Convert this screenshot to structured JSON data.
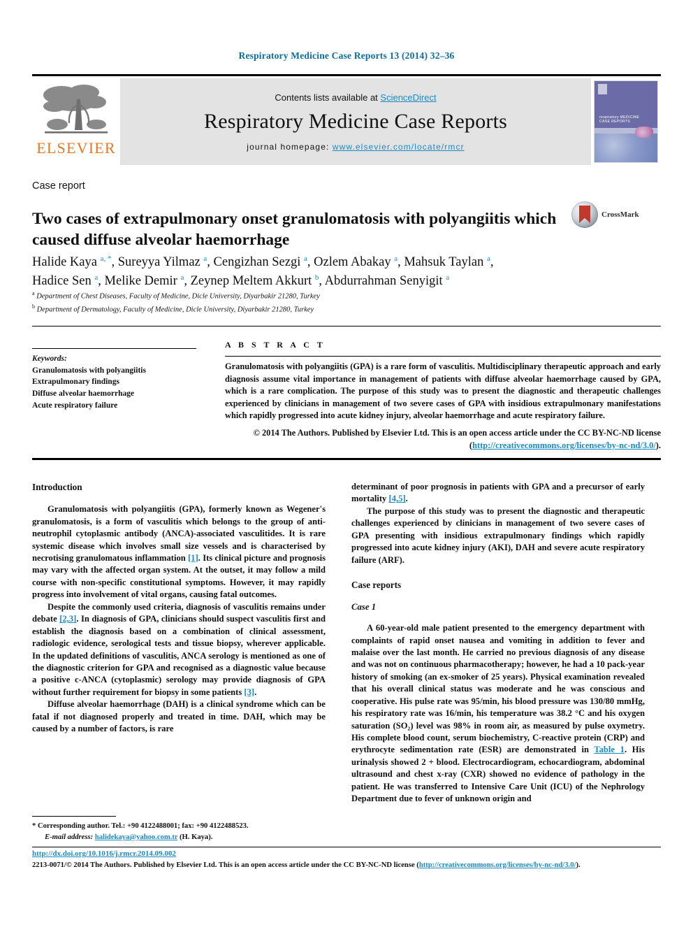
{
  "running_head": "Respiratory Medicine Case Reports 13 (2014) 32–36",
  "masthead": {
    "contents_prefix": "Contents lists available at ",
    "contents_link": "ScienceDirect",
    "journal_title": "Respiratory Medicine Case Reports",
    "homepage_prefix": "journal homepage: ",
    "homepage_url": "www.elsevier.com/locate/rmcr",
    "publisher_wordmark": "ELSEVIER",
    "cover_title_line1": "respiratory MEDICINE",
    "cover_title_line2": "CASE REPORTS"
  },
  "article": {
    "type": "Case report",
    "title": "Two cases of extrapulmonary onset granulomatosis with polyangiitis which caused diffuse alveolar haemorrhage",
    "crossmark_label": "CrossMark",
    "authors_line1": "Halide Kaya <sup>a, *</sup>, Sureyya Yilmaz <sup>a</sup>, Cengizhan Sezgi <sup>a</sup>, Ozlem Abakay <sup>a</sup>, Mahsuk Taylan <sup>a</sup>,",
    "authors_line2": "Hadice Sen <sup>a</sup>, Melike Demir <sup>a</sup>, Zeynep Meltem Akkurt <sup>b</sup>, Abdurrahman Senyigit <sup>a</sup>",
    "affiliation_a": "<sup>a</sup> Department of Chest Diseases, Faculty of Medicine, Dicle University, Diyarbakir 21280, Turkey",
    "affiliation_b": "<sup>b</sup> Department of Dermatology, Faculty of Medicine, Dicle University, Diyarbakir 21280, Turkey"
  },
  "keywords": {
    "heading": "Keywords:",
    "items": [
      "Granulomatosis with polyangiitis",
      "Extrapulmonary findings",
      "Diffuse alveolar haemorrhage",
      "Acute respiratory failure"
    ]
  },
  "abstract": {
    "heading": "A B S T R A C T",
    "body": "Granulomatosis with polyangiitis (GPA) is a rare form of vasculitis. Multidisciplinary therapeutic approach and early diagnosis assume vital importance in management of patients with diffuse alveolar haemorrhage caused by GPA, which is a rare complication. The purpose of this study was to present the diagnostic and therapeutic challenges experienced by clinicians in management of two severe cases of GPA with insidious extrapulmonary manifestations which rapidly progressed into acute kidney injury, alveolar haemorrhage and acute respiratory failure.",
    "copyright_text": "© 2014 The Authors. Published by Elsevier Ltd. This is an open access article under the CC BY-NC-ND license (",
    "copyright_link": "http://creativecommons.org/licenses/by-nc-nd/3.0/",
    "copyright_suffix": ")."
  },
  "body": {
    "introduction_heading": "Introduction",
    "intro_p1_a": "Granulomatosis with polyangiitis (GPA), formerly known as Wegener's granulomatosis, is a form of vasculitis which belongs to the group of anti-neutrophil cytoplasmic antibody (ANCA)-associated vasculitides. It is rare systemic disease which involves small size vessels and is characterised by necrotising granulomatous inflammation ",
    "intro_p1_ref": "[1]",
    "intro_p1_b": ". Its clinical picture and prognosis may vary with the affected organ system. At the outset, it may follow a mild course with non-specific constitutional symptoms. However, it may rapidly progress into involvement of vital organs, causing fatal outcomes.",
    "intro_p2_a": "Despite the commonly used criteria, diagnosis of vasculitis remains under debate ",
    "intro_p2_ref1": "[2,3]",
    "intro_p2_b": ". In diagnosis of GPA, clinicians should suspect vasculitis first and establish the diagnosis based on a combination of clinical assessment, radiologic evidence, serological tests and tissue biopsy, wherever applicable. In the updated definitions of vasculitis, ANCA serology is mentioned as one of the diagnostic criterion for GPA and recognised as a diagnostic value because a positive c-ANCA (cytoplasmic) serology may provide diagnosis of GPA without further requirement for biopsy in some patients ",
    "intro_p2_ref2": "[3]",
    "intro_p2_c": ".",
    "intro_p3": "Diffuse alveolar haemorrhage (DAH) is a clinical syndrome which can be fatal if not diagnosed properly and treated in time. DAH, which may be caused by a number of factors, is rare",
    "right_p1_a": "determinant of poor prognosis in patients with GPA and a precursor of early mortality ",
    "right_p1_ref": "[4,5]",
    "right_p1_b": ".",
    "right_p2": "The purpose of this study was to present the diagnostic and therapeutic challenges experienced by clinicians in management of two severe cases of GPA presenting with insidious extrapulmonary findings which rapidly progressed into acute kidney injury (AKI), DAH and severe acute respiratory failure (ARF).",
    "case_reports_heading": "Case reports",
    "case1_heading": "Case 1",
    "case1_p_a": "A 60-year-old male patient presented to the emergency department with complaints of rapid onset nausea and vomiting in addition to fever and malaise over the last month. He carried no previous diagnosis of any disease and was not on continuous pharmacotherapy; however, he had a 10 pack-year history of smoking (an ex-smoker of 25 years). Physical examination revealed that his overall clinical status was moderate and he was conscious and cooperative. His pulse rate was 95/min, his blood pressure was 130/80 mmHg, his respiratory rate was 16/min, his temperature was 38.2 °C and his oxygen saturation (SO₂) level was 98% in room air, as measured by pulse oxymetry. His complete blood count, serum biochemistry, C-reactive protein (CRP) and erythrocyte sedimentation rate (ESR) are demonstrated in ",
    "case1_table_link": "Table 1",
    "case1_p_b": ". His urinalysis showed 2 + blood. Electrocardiogram, echocardiogram, abdominal ultrasound and chest x-ray (CXR) showed no evidence of pathology in the patient. He was transferred to Intensive Care Unit (ICU) of the Nephrology Department due to fever of unknown origin and"
  },
  "footnote": {
    "corresponding": "* Corresponding author. Tel.: +90 4122488001; fax: +90 4122488523.",
    "email_label": "E-mail address:",
    "email": "halidekaya@yahoo.com.tr",
    "email_suffix": " (H. Kaya)."
  },
  "footer": {
    "doi": "http://dx.doi.org/10.1016/j.rmcr.2014.09.002",
    "line_prefix": "2213-0071/© 2014 The Authors. Published by Elsevier Ltd. This is an open access article under the CC BY-NC-ND license (",
    "line_link": "http://creativecommons.org/licenses/by-nc-nd/3.0/",
    "line_suffix": ")."
  },
  "colors": {
    "link_blue": "#1b8ac4",
    "running_head_blue": "#0b6ca0",
    "elsevier_orange": "#e87722",
    "masthead_gray": "#e3e3e3"
  }
}
